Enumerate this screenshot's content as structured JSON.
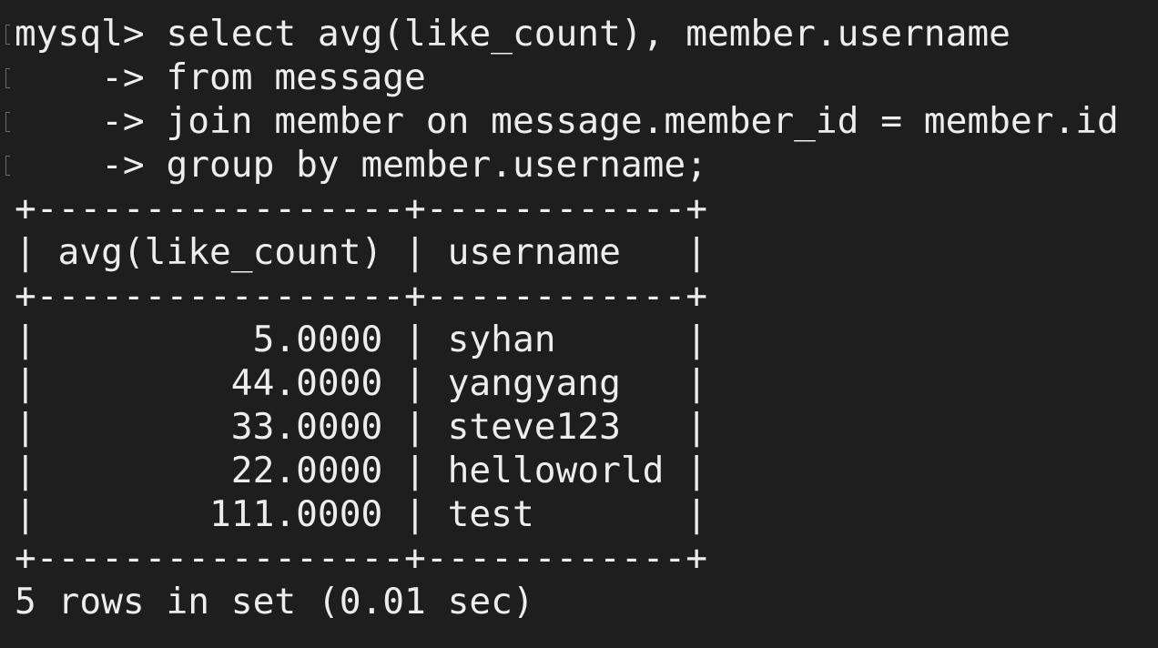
{
  "terminal": {
    "lines": [
      "mysql> select avg(like_count), member.username",
      "    -> from message",
      "    -> join member on message.member_id = member.id",
      "    -> group by member.username;",
      "+-----------------+------------+",
      "| avg(like_count) | username   |",
      "+-----------------+------------+",
      "|          5.0000 | syhan      |",
      "|         44.0000 | yangyang   |",
      "|         33.0000 | steve123   |",
      "|         22.0000 | helloworld |",
      "|        111.0000 | test       |",
      "+-----------------+------------+",
      "5 rows in set (0.01 sec)"
    ]
  },
  "query_result": {
    "columns": [
      "avg(like_count)",
      "username"
    ],
    "rows": [
      [
        "5.0000",
        "syhan"
      ],
      [
        "44.0000",
        "yangyang"
      ],
      [
        "33.0000",
        "steve123"
      ],
      [
        "22.0000",
        "helloworld"
      ],
      [
        "111.0000",
        "test"
      ]
    ],
    "summary": "5 rows in set (0.01 sec)"
  },
  "colors": {
    "background": "#1e1e1e",
    "text": "#ededed"
  }
}
